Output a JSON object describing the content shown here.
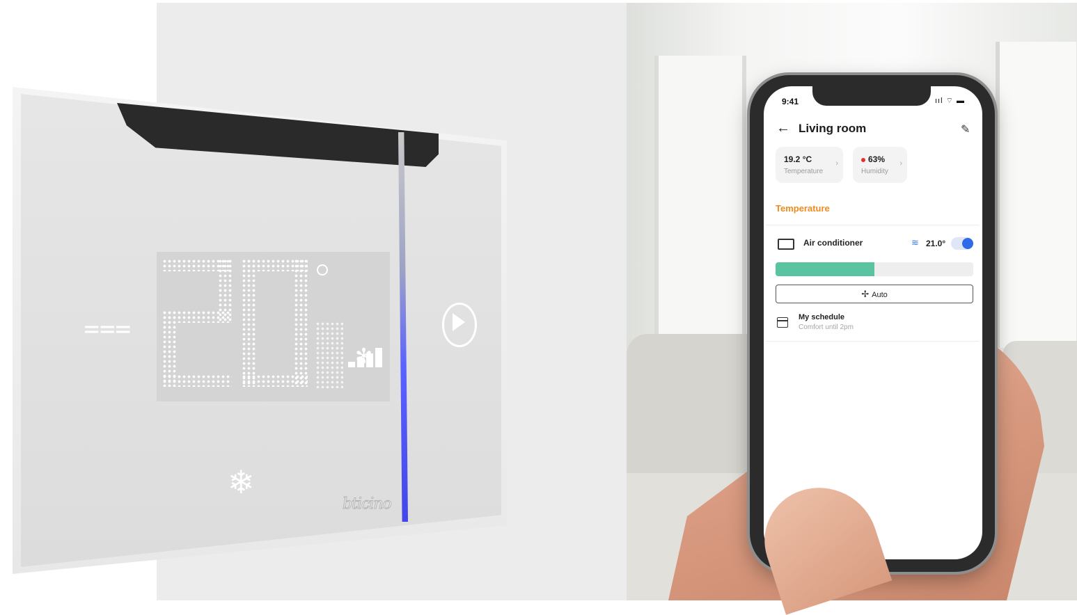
{
  "thermostat": {
    "temperature_digits": "20",
    "decimal_digit": "8",
    "brand": "bticino",
    "accent_color": "#4346e8"
  },
  "phone": {
    "status_bar": {
      "time": "9:41",
      "icons": "ııl ⌔ ▬"
    },
    "header": {
      "title": "Living room",
      "back_icon": "arrow-left-icon",
      "edit_icon": "pencil-icon"
    },
    "chips": [
      {
        "value": "19.2 °C",
        "label": "Temperature"
      },
      {
        "value": "63%",
        "label": "Humidity",
        "indicator_color": "#e53030"
      }
    ],
    "section_title": "Temperature",
    "section_color": "#f08a1c",
    "air_conditioner": {
      "label": "Air conditioner",
      "setpoint": "21.0°",
      "enabled": true,
      "level_fraction": 0.5,
      "mode_label": "Auto",
      "accent_color": "#2e6be6",
      "fill_color": "#59c3a2"
    },
    "schedule": {
      "title": "My schedule",
      "subtitle": "Comfort until 2pm"
    }
  }
}
